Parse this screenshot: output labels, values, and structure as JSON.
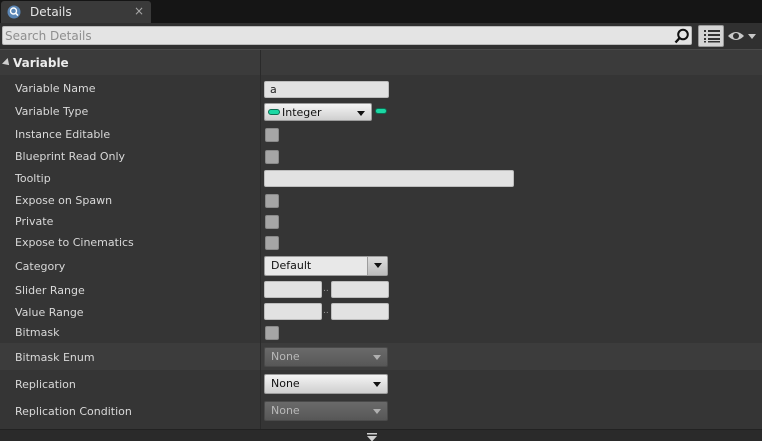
{
  "tab": {
    "title": "Details",
    "close": "×"
  },
  "search": {
    "placeholder": "Search Details",
    "value": ""
  },
  "category": {
    "label": "Variable"
  },
  "rows": {
    "variable_name": {
      "label": "Variable Name",
      "value": "a"
    },
    "variable_type": {
      "label": "Variable Type",
      "value": "Integer"
    },
    "instance_editable": {
      "label": "Instance Editable",
      "checked": false
    },
    "blueprint_read_only": {
      "label": "Blueprint Read Only",
      "checked": false
    },
    "tooltip": {
      "label": "Tooltip",
      "value": ""
    },
    "expose_on_spawn": {
      "label": "Expose on Spawn",
      "checked": false
    },
    "private": {
      "label": "Private",
      "checked": false
    },
    "expose_to_cinematics": {
      "label": "Expose to Cinematics",
      "checked": false
    },
    "category": {
      "label": "Category",
      "value": "Default"
    },
    "slider_range": {
      "label": "Slider Range",
      "min": "",
      "max": "",
      "sep": ".."
    },
    "value_range": {
      "label": "Value Range",
      "min": "",
      "max": "",
      "sep": ".."
    },
    "bitmask": {
      "label": "Bitmask",
      "checked": false
    },
    "bitmask_enum": {
      "label": "Bitmask Enum",
      "value": "None"
    },
    "replication": {
      "label": "Replication",
      "value": "None"
    },
    "replication_condition": {
      "label": "Replication Condition",
      "value": "None"
    }
  },
  "icons": {
    "tab": "details-magnifier-icon",
    "search": "search-icon",
    "view": "list-view-icon",
    "eye": "eye-visibility-icon",
    "more": "show-advanced-arrow-icon"
  },
  "colors": {
    "integer_pin": "#1bd8a4",
    "panel_bg": "#353535",
    "category_bg": "#3b3b3b"
  }
}
